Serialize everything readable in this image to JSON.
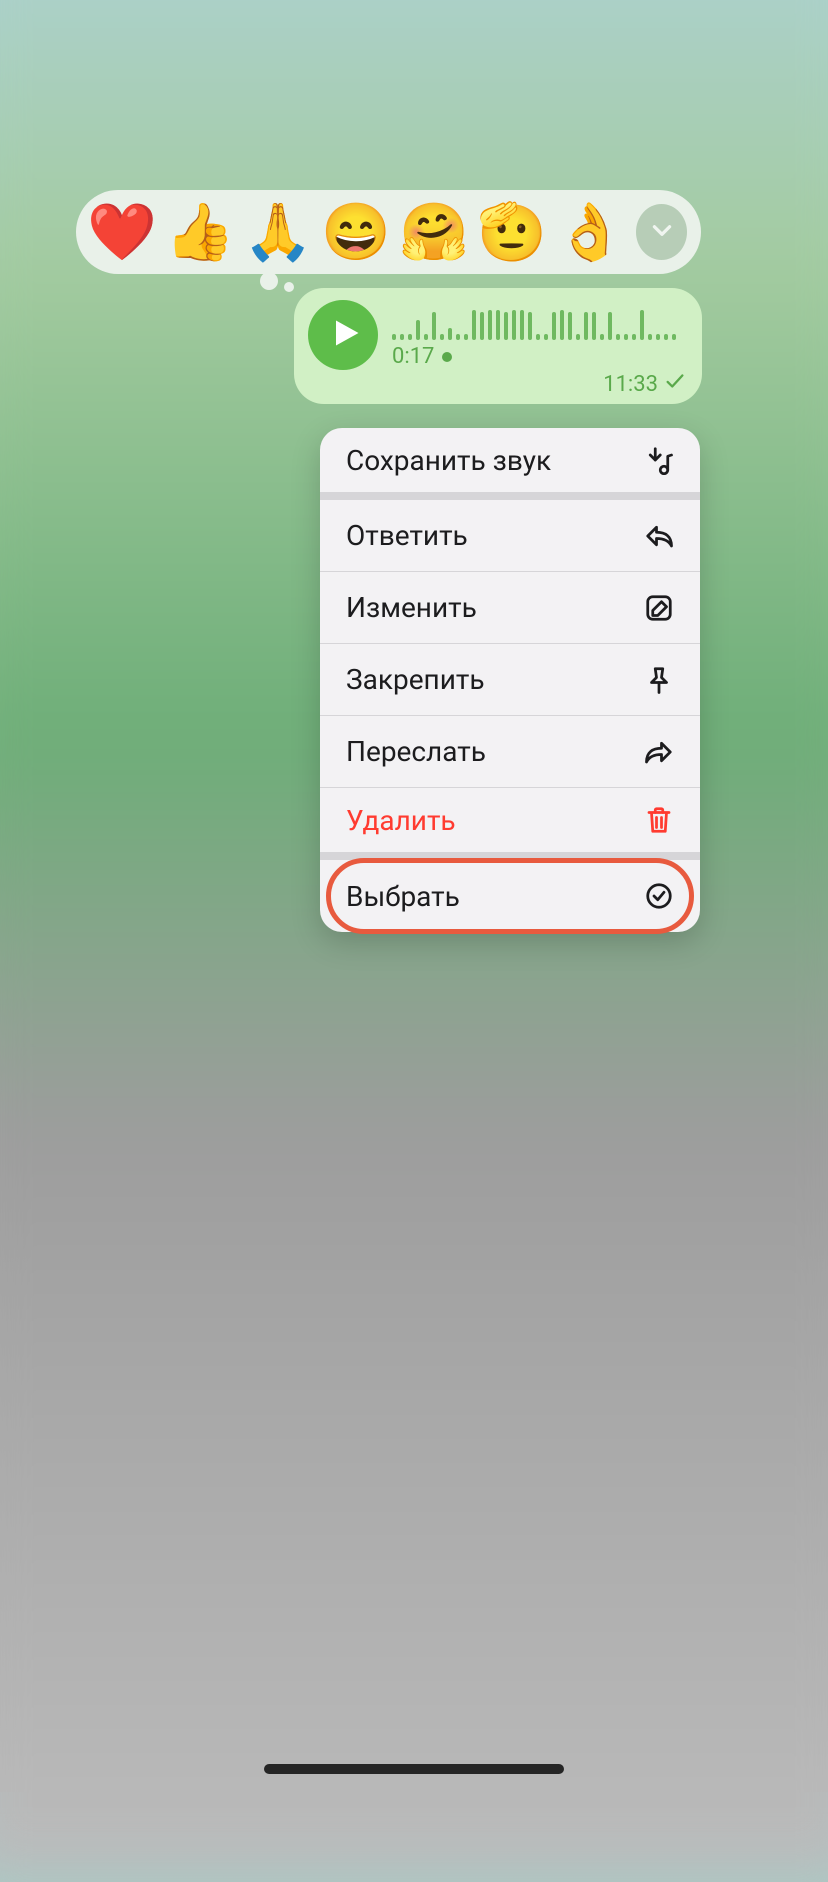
{
  "reactions": {
    "emojis": [
      "❤️",
      "👍",
      "🙏",
      "😄",
      "🤗",
      "🫡",
      "👌"
    ],
    "more_icon": "chevron-down"
  },
  "voice_message": {
    "duration": "0:17",
    "timestamp": "11:33",
    "status": "read",
    "waveform_heights": [
      6,
      6,
      6,
      20,
      6,
      28,
      6,
      12,
      6,
      6,
      30,
      28,
      30,
      30,
      28,
      30,
      30,
      28,
      6,
      6,
      28,
      30,
      28,
      6,
      28,
      28,
      6,
      28,
      6,
      6,
      6,
      30,
      6,
      6,
      6,
      6
    ],
    "colors": {
      "bubble": "#d1f0c5",
      "accent": "#5aa94b",
      "play": "#5ebd4a"
    }
  },
  "menu": {
    "items": [
      {
        "label": "Сохранить звук",
        "icon": "download-music",
        "destructive": false,
        "strong_sep": true
      },
      {
        "label": "Ответить",
        "icon": "reply",
        "destructive": false,
        "strong_sep": false
      },
      {
        "label": "Изменить",
        "icon": "edit",
        "destructive": false,
        "strong_sep": false
      },
      {
        "label": "Закрепить",
        "icon": "pin",
        "destructive": false,
        "strong_sep": false
      },
      {
        "label": "Переслать",
        "icon": "forward",
        "destructive": false,
        "strong_sep": false
      },
      {
        "label": "Удалить",
        "icon": "trash",
        "destructive": true,
        "strong_sep": true
      },
      {
        "label": "Выбрать",
        "icon": "circle-check",
        "destructive": false,
        "strong_sep": false
      }
    ],
    "highlighted_index": 6
  }
}
